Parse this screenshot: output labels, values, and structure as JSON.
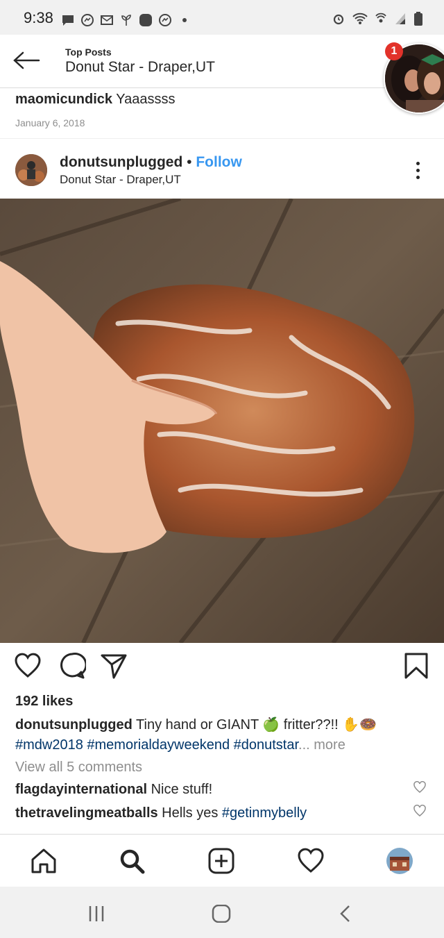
{
  "status_bar": {
    "time": "9:38",
    "left_icons": [
      "message-icon",
      "messenger-icon",
      "mail-icon",
      "plant-icon",
      "circle-app-icon",
      "messenger-icon",
      "more-dot-icon"
    ],
    "right_icons": [
      "alarm-icon",
      "wifi-icon",
      "hotspot-icon",
      "signal-icon",
      "battery-icon"
    ]
  },
  "header": {
    "subtitle": "Top Posts",
    "title": "Donut Star - Draper,UT",
    "chat_head_badge": "1"
  },
  "previous_comment": {
    "username": "maomicundick",
    "text": " Yaaassss",
    "date": "January 6, 2018"
  },
  "post": {
    "username": "donutsunplugged",
    "separator": " • ",
    "follow_label": "Follow",
    "location": "Donut Star - Draper,UT",
    "likes": "192 likes",
    "caption_username": "donutsunplugged",
    "caption_text": " Tiny hand or GIANT 🍏 fritter??!! ✋🍩",
    "caption_tags": "#mdw2018 #memorialdayweekend #donutstar",
    "caption_more": "... more",
    "view_all_comments": "View all 5 comments",
    "comments": [
      {
        "username": "flagdayinternational",
        "text": " Nice stuff!",
        "tag": ""
      },
      {
        "username": "thetravelingmeatballs",
        "text": " Hells yes ",
        "tag": "#getinmybelly"
      }
    ]
  },
  "colors": {
    "link_blue": "#3897f0",
    "hashtag": "#003569",
    "muted": "#8e8e8e",
    "badge_red": "#e2322a"
  }
}
